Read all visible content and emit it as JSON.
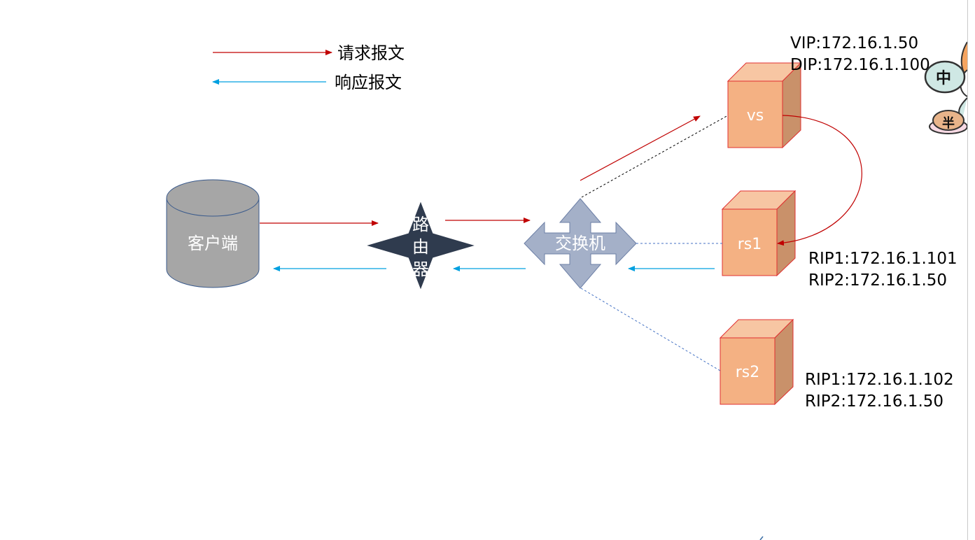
{
  "legend": {
    "request_label": "请求报文",
    "response_label": "响应报文"
  },
  "nodes": {
    "client": "客户端",
    "router": [
      "路",
      "由",
      "器"
    ],
    "switch": "交换机",
    "vs": "vs",
    "rs1": "rs1",
    "rs2": "rs2"
  },
  "ip_labels": {
    "vs": [
      "VIP:172.16.1.50",
      "DIP:172.16.1.100"
    ],
    "rs1": [
      "RIP1:172.16.1.101",
      "RIP2:172.16.1.50"
    ],
    "rs2": [
      "RIP1:172.16.1.102",
      "RIP2:172.16.1.50"
    ]
  },
  "sticker": {
    "top_glyph": "中",
    "bottom_glyph": "半"
  },
  "colors": {
    "request": "#c00000",
    "response": "#00a0e0",
    "server_front": "#f4b183",
    "server_side": "#c9916a",
    "server_top": "#f7c6a3",
    "server_border": "#e03030",
    "client_body": "#a6a6a6",
    "router": "#2f3b4e",
    "switch": "#a4b0c8"
  }
}
